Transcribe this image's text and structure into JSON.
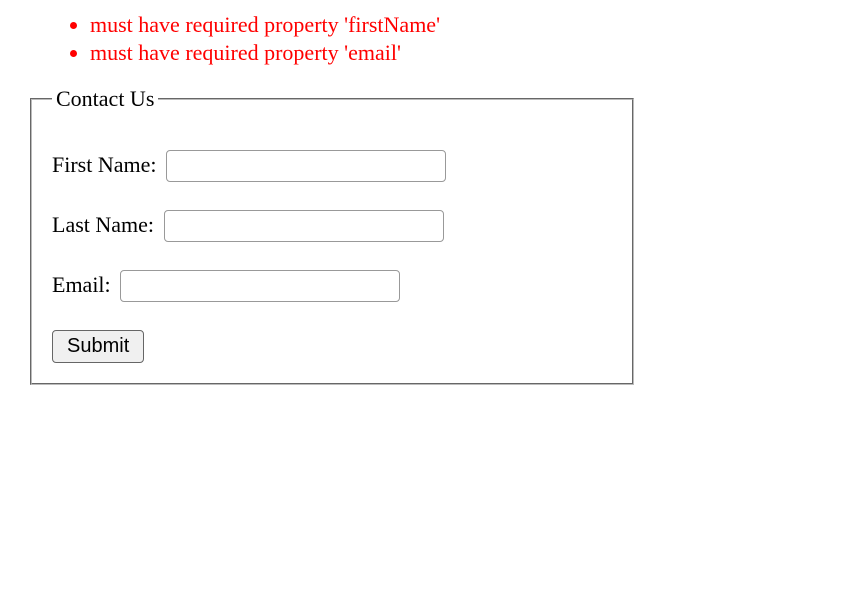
{
  "errors": [
    "must have required property 'firstName'",
    "must have required property 'email'"
  ],
  "form": {
    "legend": "Contact Us",
    "fields": {
      "firstName": {
        "label": "First Name:",
        "value": ""
      },
      "lastName": {
        "label": "Last Name:",
        "value": ""
      },
      "email": {
        "label": "Email:",
        "value": ""
      }
    },
    "submitLabel": "Submit"
  }
}
